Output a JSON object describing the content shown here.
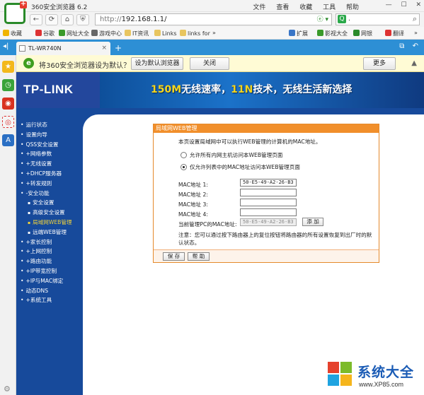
{
  "browser": {
    "title": "360安全浏览器 6.2",
    "menu": [
      "文件",
      "查看",
      "收藏",
      "工具",
      "帮助"
    ],
    "url_prefix": "http://",
    "url_host": "192.168.1.1/",
    "search_value": "."
  },
  "bookmarks": {
    "items": [
      "收藏",
      "谷歌",
      "网址大全",
      "游戏中心",
      "IT资讯",
      "Links",
      "links for"
    ],
    "more": "»",
    "right_items": [
      "扩展",
      "影视大全",
      "网银",
      "翻译"
    ]
  },
  "tab": {
    "label": "TL-WR740N",
    "close": "×",
    "new_tab": "+"
  },
  "notify": {
    "message": "将360安全浏览器设为默认？",
    "set_default": "设为默认浏览器",
    "close": "关闭",
    "more": "更多"
  },
  "router": {
    "brand": "TP-LINK",
    "slogan_part1": "150M",
    "slogan_part2": "无线速率，",
    "slogan_part3": "11N",
    "slogan_part4": "技术，无线生活新选择",
    "menu": [
      {
        "label": "运行状态",
        "sub": false,
        "active": false
      },
      {
        "label": "设置向导",
        "sub": false,
        "active": false
      },
      {
        "label": "QSS安全设置",
        "sub": false,
        "active": false
      },
      {
        "label": "+网络参数",
        "sub": false,
        "active": false
      },
      {
        "label": "+无线设置",
        "sub": false,
        "active": false
      },
      {
        "label": "+DHCP服务器",
        "sub": false,
        "active": false
      },
      {
        "label": "+转发规则",
        "sub": false,
        "active": false
      },
      {
        "label": "-安全功能",
        "sub": false,
        "active": false
      },
      {
        "label": "安全设置",
        "sub": true,
        "active": false
      },
      {
        "label": "高级安全设置",
        "sub": true,
        "active": false
      },
      {
        "label": "局域网WEB管理",
        "sub": true,
        "active": true
      },
      {
        "label": "远端WEB管理",
        "sub": true,
        "active": false
      },
      {
        "label": "+家长控制",
        "sub": false,
        "active": false
      },
      {
        "label": "+上网控制",
        "sub": false,
        "active": false
      },
      {
        "label": "+路由功能",
        "sub": false,
        "active": false
      },
      {
        "label": "+IP带宽控制",
        "sub": false,
        "active": false
      },
      {
        "label": "+IP与MAC绑定",
        "sub": false,
        "active": false
      },
      {
        "label": "动态DNS",
        "sub": false,
        "active": false
      },
      {
        "label": "+系统工具",
        "sub": false,
        "active": false
      }
    ]
  },
  "panel": {
    "title": "局域网WEB管理",
    "description": "本页设置局域网中可以执行WEB管理的计算机的MAC地址。",
    "radio_all": "允许所有内网主机访问本WEB管理页面",
    "radio_list": "仅允许列表中的MAC地址访问本WEB管理页面",
    "mac_labels": [
      "MAC地址 1:",
      "MAC地址 2:",
      "MAC地址 3:",
      "MAC地址 4:"
    ],
    "mac_values": [
      "50-E5-49-A2-26-B3",
      "",
      "",
      ""
    ],
    "current_label": "当前管理PC的MAC地址:",
    "current_value": "50-E5-49-A2-26-B3",
    "add_button": "添 加",
    "note": "注意：您可以通过按下路由器上的复位按钮将路由器的所有设置恢复到出厂时的默认状态。",
    "save_button": "保 存",
    "help_button": "帮 助"
  },
  "watermark": {
    "text": "系统大全",
    "url": "www.XP85.com"
  },
  "colors": {
    "tabbar": "#2d8fd5",
    "router_nav": "#174a9b",
    "panel_accent": "#f18f2b",
    "active_menu": "#f0d23a"
  }
}
